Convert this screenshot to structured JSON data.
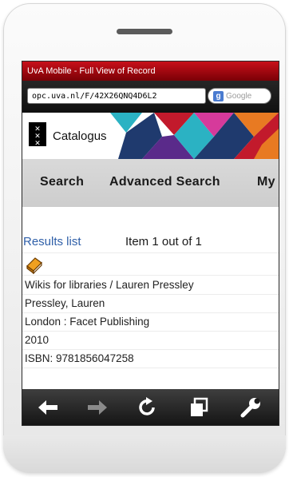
{
  "browser": {
    "window_title": "UvA Mobile - Full View of Record",
    "url": "opc.uva.nl/F/42X26QNQ4D6L2",
    "search_placeholder": "Google",
    "search_engine_icon": "google-g-icon"
  },
  "site": {
    "brand": "Catalogus",
    "logo_icon": "uva-crosses-logo",
    "banner_colors": [
      "#1f3a6e",
      "#c21a2c",
      "#e87a22",
      "#2bb2c3",
      "#5a2a8a",
      "#d63a9b"
    ]
  },
  "nav": {
    "items": [
      {
        "label": "Search"
      },
      {
        "label": "Advanced Search"
      },
      {
        "label": "My"
      }
    ]
  },
  "results": {
    "link_label": "Results list",
    "count_label": "Item 1 out of 1"
  },
  "record": {
    "format_icon": "book-icon",
    "title": "Wikis for libraries / Lauren Pressley",
    "author": "Pressley, Lauren",
    "publisher": "London : Facet Publishing",
    "year": "2010",
    "isbn": "ISBN: 9781856047258"
  },
  "toolbar": {
    "buttons": [
      "back-arrow-icon",
      "forward-arrow-icon",
      "reload-icon",
      "tabs-icon",
      "settings-wrench-icon"
    ],
    "colors": {
      "active": "#ffffff",
      "disabled": "#8a8a8a"
    }
  }
}
